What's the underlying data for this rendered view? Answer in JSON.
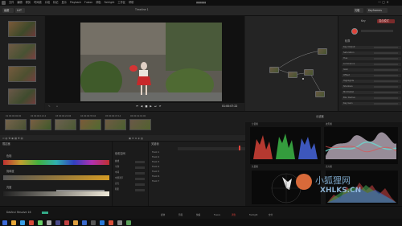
{
  "app": {
    "title": "Davinci Resolve 16",
    "window_title": "gggggg",
    "project_name": "Timeline 1"
  },
  "menu": [
    "文件",
    "编辑",
    "修剪",
    "时间线",
    "片段",
    "标记",
    "显示",
    "Playback",
    "Fusion",
    "调色",
    "Fairlight",
    "工作区",
    "帮助"
  ],
  "toolbar": {
    "left_btn1": "画廊",
    "left_btn2": "LUT",
    "right_btn1": "光箱",
    "right_btn2": "Keyframes"
  },
  "viewer": {
    "timecode": "01:00:07:22"
  },
  "inspector": {
    "key_label": "Key",
    "key_value": "混合模式",
    "outline_label": "轮廓",
    "items": [
      "Key Output",
      "Saturation",
      "Hue",
      "Luminance",
      "Gain",
      "Offset",
      "Highlights",
      "Shadows",
      "Mid Detail",
      "Blur Radius",
      "Key Gain"
    ]
  },
  "clips": [
    {
      "num": "01",
      "tc": "00:00:00:00"
    },
    {
      "num": "02",
      "tc": "00:00:11:12"
    },
    {
      "num": "03",
      "tc": "00:00:22:06"
    },
    {
      "num": "04",
      "tc": "00:00:35:04"
    },
    {
      "num": "05",
      "tc": "00:00:47:14"
    },
    {
      "num": "06",
      "tc": "00:01:01:00"
    }
  ],
  "lower": {
    "panel1_title": "限定器",
    "section_hsl": "色相",
    "section_sat": "饱和度",
    "section_lum": "亮度",
    "panel2_title": "色彩空间",
    "panel3_title": "关键帧",
    "properties": [
      "曲线",
      "平滑",
      "中间",
      "中部调节",
      "高光",
      "阴影"
    ],
    "tracks": [
      "Track 1",
      "Track 2",
      "Track 3",
      "Track 4",
      "Track 5",
      "Track 6",
      "Track 7"
    ]
  },
  "scopes": {
    "title": "示波器",
    "label1": "分量图",
    "label2": "波形图",
    "label3": "矢量图",
    "label4": "直方图"
  },
  "bottom_pages": [
    "媒体",
    "剪辑",
    "快编",
    "Fusion",
    "调色",
    "Fairlight",
    "交付"
  ],
  "bottom_status": "DaVinci Resolve 16",
  "watermark": {
    "main": "小狐狸网",
    "sub": "XHLKS.CN"
  },
  "colors": {
    "accent": "#e0433a",
    "blue": "#5a84d8",
    "bg": "#1c1c1c"
  }
}
